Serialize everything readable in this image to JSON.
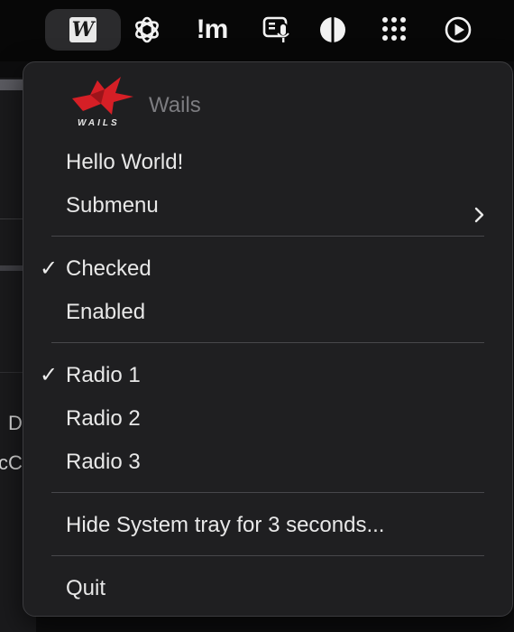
{
  "menubar": {
    "icons": [
      {
        "name": "wails-tray-icon",
        "glyph": "W"
      },
      {
        "name": "openai-icon"
      },
      {
        "name": "im-icon",
        "text": "!m"
      },
      {
        "name": "dictation-icon"
      },
      {
        "name": "contrast-icon"
      },
      {
        "name": "grid-dots-icon"
      },
      {
        "name": "play-circle-icon"
      }
    ]
  },
  "menu": {
    "header_title": "Wails",
    "logo_text": "WAILS",
    "items": {
      "hello": "Hello World!",
      "submenu": "Submenu",
      "checked": "Checked",
      "enabled": "Enabled",
      "radio1": "Radio 1",
      "radio2": "Radio 2",
      "radio3": "Radio 3",
      "hide_tray": "Hide System tray for 3 seconds...",
      "quit": "Quit"
    },
    "check_mark": "✓"
  },
  "background": {
    "text1": "D",
    "text2": "cC"
  },
  "colors": {
    "menu_bg": "#1f1f21",
    "logo_red": "#d51f26",
    "separator": "#47474b"
  }
}
